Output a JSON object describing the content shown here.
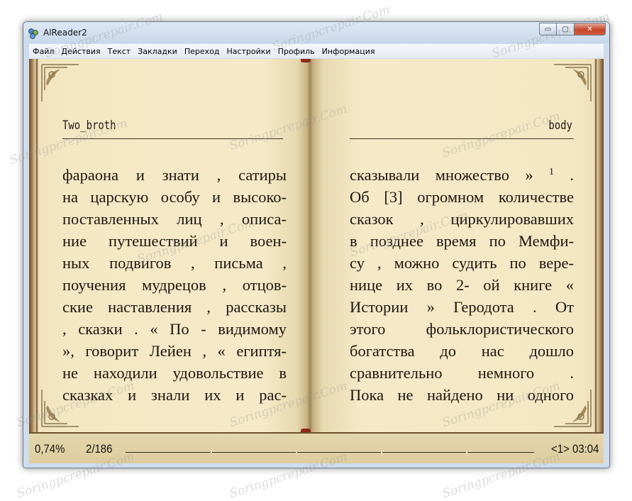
{
  "window": {
    "title": "AlReader2",
    "controls": {
      "minimize": "▭",
      "maximize": "▢",
      "close": "✕"
    }
  },
  "menu": [
    "Файл",
    "Действия",
    "Текст",
    "Закладки",
    "Переход",
    "Настройки",
    "Профиль",
    "Информация"
  ],
  "book": {
    "left_header": "Two_broth",
    "right_header": "body",
    "left_lines": [
      "фараона и знати , сатиры",
      "на царскую особу и высоко-",
      "поставленных лиц , описа-",
      "ние путешествий и воен-",
      "ных подвигов , письма ,",
      "поучения мудрецов , отцов-",
      "ские наставления , рассказы",
      ", сказки . « По - видимому",
      "», говорит Лейен , « египтя-",
      "не находили удовольствие в",
      "сказках и знали их и рас-"
    ],
    "right_first_line_text": "сказывали множество »",
    "right_first_line_footnote": "1",
    "right_first_line_end": ".",
    "right_lines": [
      "Об [3] огромном количестве",
      "сказок , циркулировавших",
      "в позднее время по Мемфи-",
      "су , можно судить по вере-",
      "нице их во 2- ой книге «",
      "Истории » Геродота . От",
      "этого фольклористического",
      "богатства до нас дошло",
      "сравнительно немного .",
      "Пока не найдено ни одного"
    ]
  },
  "status": {
    "percent": "0,74%",
    "page": "2/186",
    "chapter": "<1>",
    "clock": "03:04"
  },
  "watermark_text": "Soringpcrepair.Com",
  "colors": {
    "page": "#f4e7c4",
    "spine_mark": "#8c2818",
    "frame": "#7b5a3a"
  }
}
